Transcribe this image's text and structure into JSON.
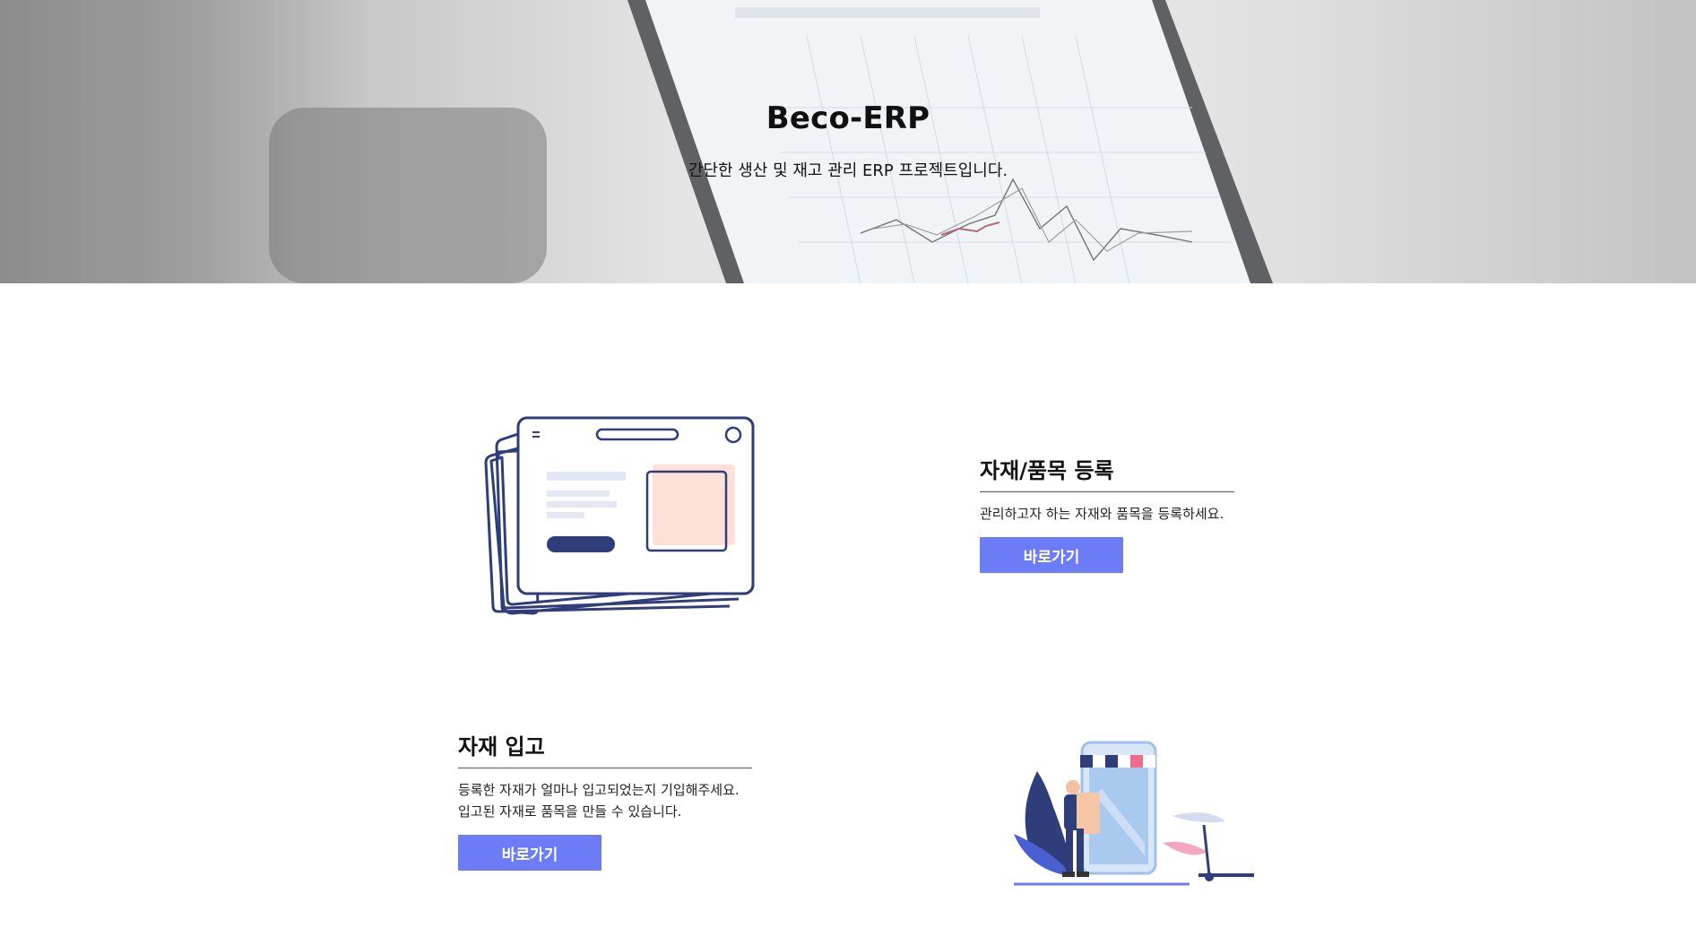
{
  "hero": {
    "title": "Beco-ERP",
    "subtitle": "간단한 생산 및 재고 관리 ERP 프로젝트입니다."
  },
  "features": [
    {
      "title": "자재/품목 등록",
      "description_lines": [
        "관리하고자 하는 자재와 품목을 등록하세요."
      ],
      "button_label": "바로가기",
      "illustration": "browser-cards-icon"
    },
    {
      "title": "자재 입고",
      "description_lines": [
        "등록한 자재가 얼마나 입고되었는지 기입해주세요.",
        "입고된 자재로 품목을 만들 수 있습니다."
      ],
      "button_label": "바로가기",
      "illustration": "delivery-store-icon"
    }
  ],
  "colors": {
    "button": "#6b7cf6",
    "illustration_navy": "#2f3e7a",
    "illustration_peach": "#fde0d8"
  }
}
